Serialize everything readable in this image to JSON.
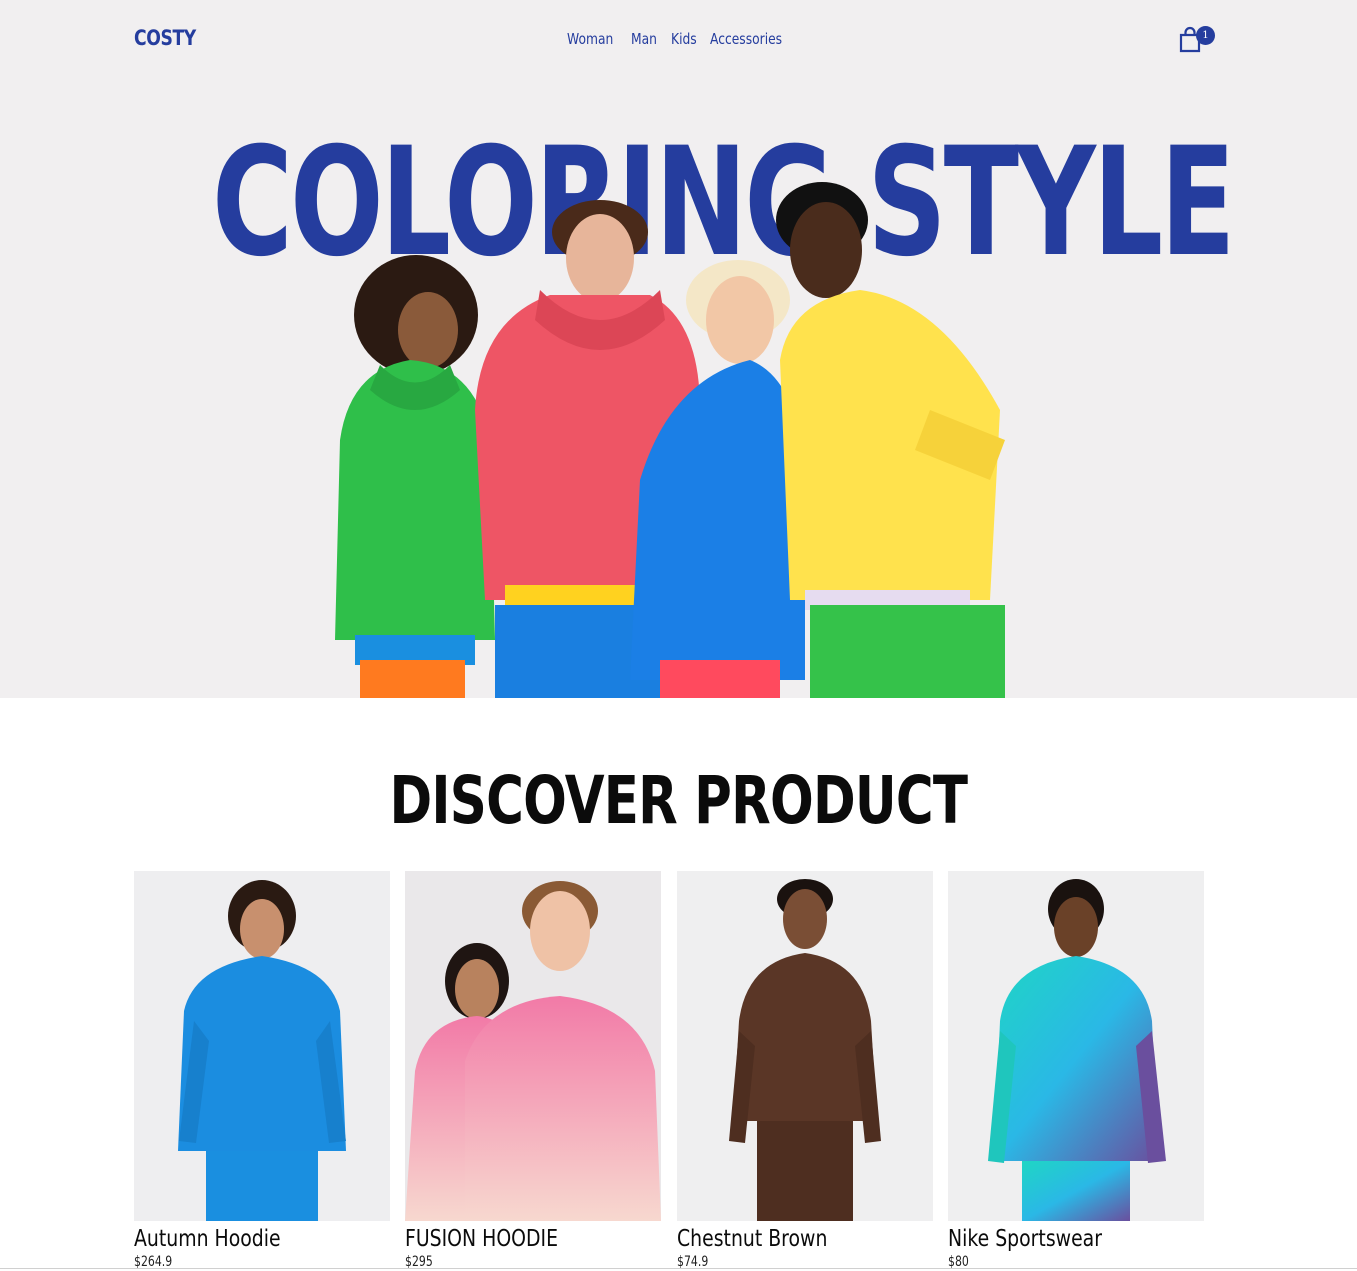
{
  "header": {
    "logo": "COSTY",
    "nav": [
      {
        "label": "Woman"
      },
      {
        "label": "Man"
      },
      {
        "label": "Kids"
      },
      {
        "label": "Accessories"
      }
    ],
    "cart_count": "1"
  },
  "hero": {
    "title": "COLORING STYLE"
  },
  "discover": {
    "title": "DISCOVER PRODUCT",
    "products": [
      {
        "name": "Autumn Hoodie",
        "price": "$264.9"
      },
      {
        "name": "FUSION HOODIE",
        "price": "$295"
      },
      {
        "name": "Chestnut Brown",
        "price": "$74.9"
      },
      {
        "name": "Nike Sportswear",
        "price": "$80"
      }
    ]
  },
  "colors": {
    "brand_blue": "#253d9e",
    "hero_bg": "#f1eff0",
    "text_dark": "#0b0b0b"
  },
  "icons": {
    "cart": "shopping-bag-icon"
  }
}
